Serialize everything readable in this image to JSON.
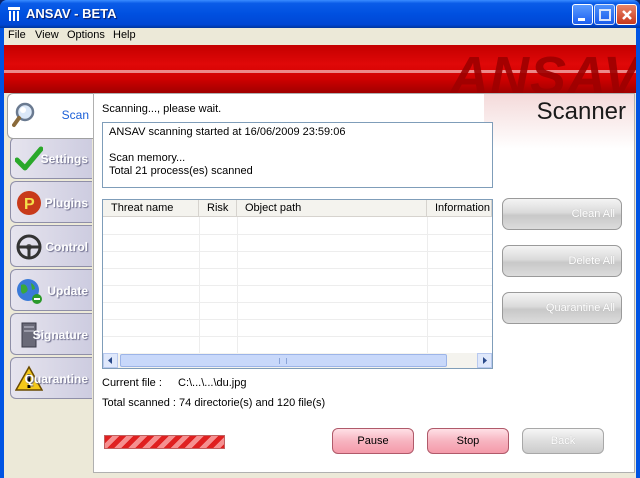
{
  "window": {
    "title": "ANSAV - BETA"
  },
  "menu": [
    "File",
    "View",
    "Options",
    "Help"
  ],
  "banner": {
    "logo": "ANSAV"
  },
  "nav": [
    {
      "label": "Scan",
      "icon": "magnifier-icon",
      "active": true
    },
    {
      "label": "Settings",
      "icon": "checkmark-icon"
    },
    {
      "label": "Plugins",
      "icon": "plugin-p-icon"
    },
    {
      "label": "Control",
      "icon": "steering-wheel-icon"
    },
    {
      "label": "Update",
      "icon": "globe-update-icon"
    },
    {
      "label": "Signature",
      "icon": "server-tower-icon"
    },
    {
      "label": "Quarantine",
      "icon": "warning-triangle-icon"
    }
  ],
  "panel": {
    "title": "Scanner",
    "status": "Scanning..., please wait.",
    "log": [
      "ANSAV scanning started at 16/06/2009 23:59:06",
      "",
      "Scan memory...",
      "Total 21 process(es) scanned"
    ],
    "table": {
      "columns": [
        "Threat name",
        "Risk",
        "Object path",
        "Information"
      ],
      "rows": []
    },
    "current_file_label": "Current file :",
    "current_file": "C:\\...\\...\\du.jpg",
    "total_scanned": "Total scanned : 74 directorie(s) and 120 file(s)"
  },
  "side_buttons": {
    "clean_all": "Clean All",
    "delete_all": "Delete All",
    "quarantine_all": "Quarantine All"
  },
  "action_buttons": {
    "pause": "Pause",
    "stop": "Stop",
    "back": "Back"
  },
  "colors": {
    "banner_red": "#d00000",
    "accent_blue": "#1a5fd8",
    "progress_red": "#e02020"
  }
}
